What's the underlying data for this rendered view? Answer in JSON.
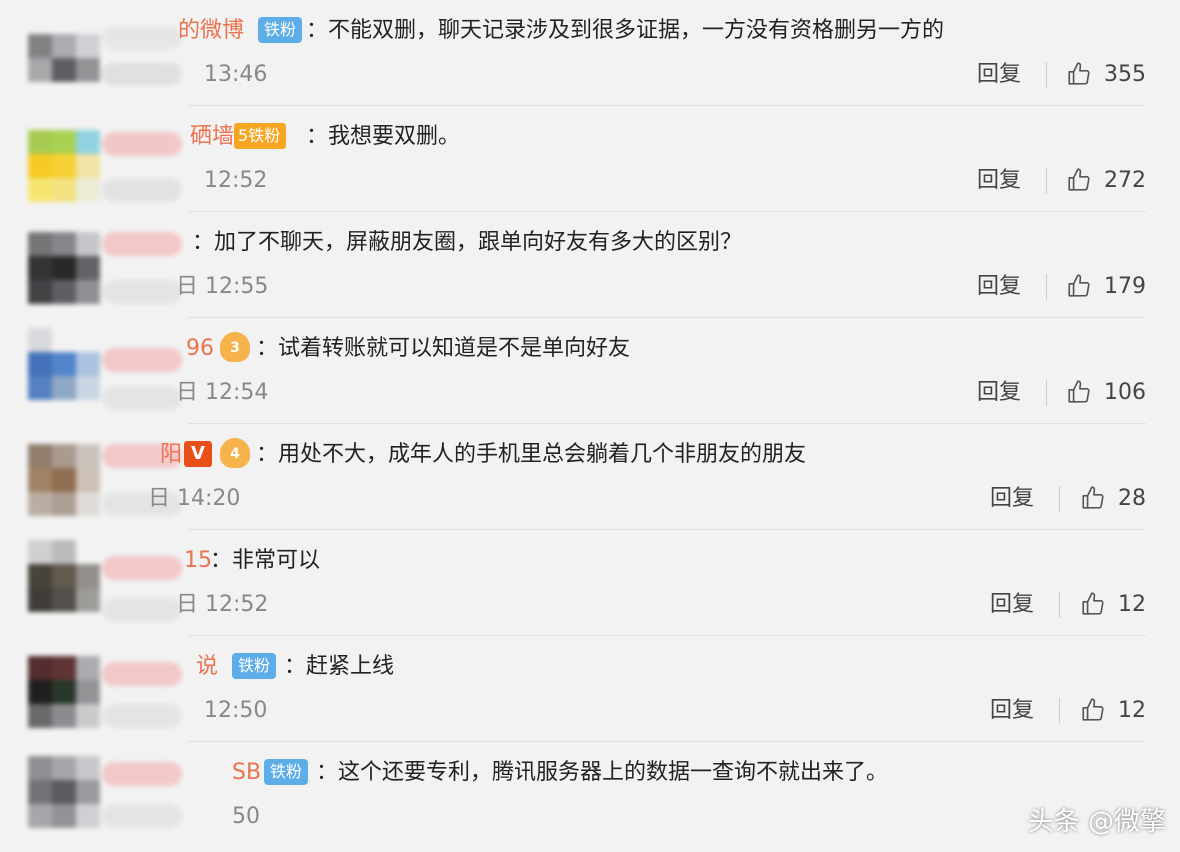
{
  "reply_label": "回复",
  "comments": [
    {
      "name": "的微博",
      "badge": "铁粉",
      "text": "：不能双删，聊天记录涉及到很多证据，一方没有资格删另一方的",
      "time": "13:46",
      "likes": "355"
    },
    {
      "name": "硒墙",
      "badge": "铁粉",
      "crown": "5",
      "text": "：我想要双删。",
      "time": "12:52",
      "likes": "272"
    },
    {
      "name": "",
      "text": "：加了不聊天，屏蔽朋友圈，跟单向好友有多大的区别？",
      "time": "日 12:55",
      "likes": "179"
    },
    {
      "name": "96",
      "crown": "3",
      "text": "：试着转账就可以知道是不是单向好友",
      "time": "日 12:54",
      "likes": "106"
    },
    {
      "name": "阳",
      "verified": "V",
      "crown": "4",
      "text": "：用处不大，成年人的手机里总会躺着几个非朋友的朋友",
      "time": "日 14:20",
      "likes": "28"
    },
    {
      "name": "15",
      "text": "：非常可以",
      "time": "日 12:52",
      "likes": "12"
    },
    {
      "name": "说",
      "badge": "铁粉",
      "text": "：赶紧上线",
      "time": "12:50",
      "likes": "12"
    },
    {
      "name": "SB",
      "badge": "铁粉",
      "text": "：这个还要专利，腾讯服务器上的数据一查询不就出来了。",
      "time": "50",
      "likes": ""
    }
  ],
  "watermark": "头条 @微擎"
}
